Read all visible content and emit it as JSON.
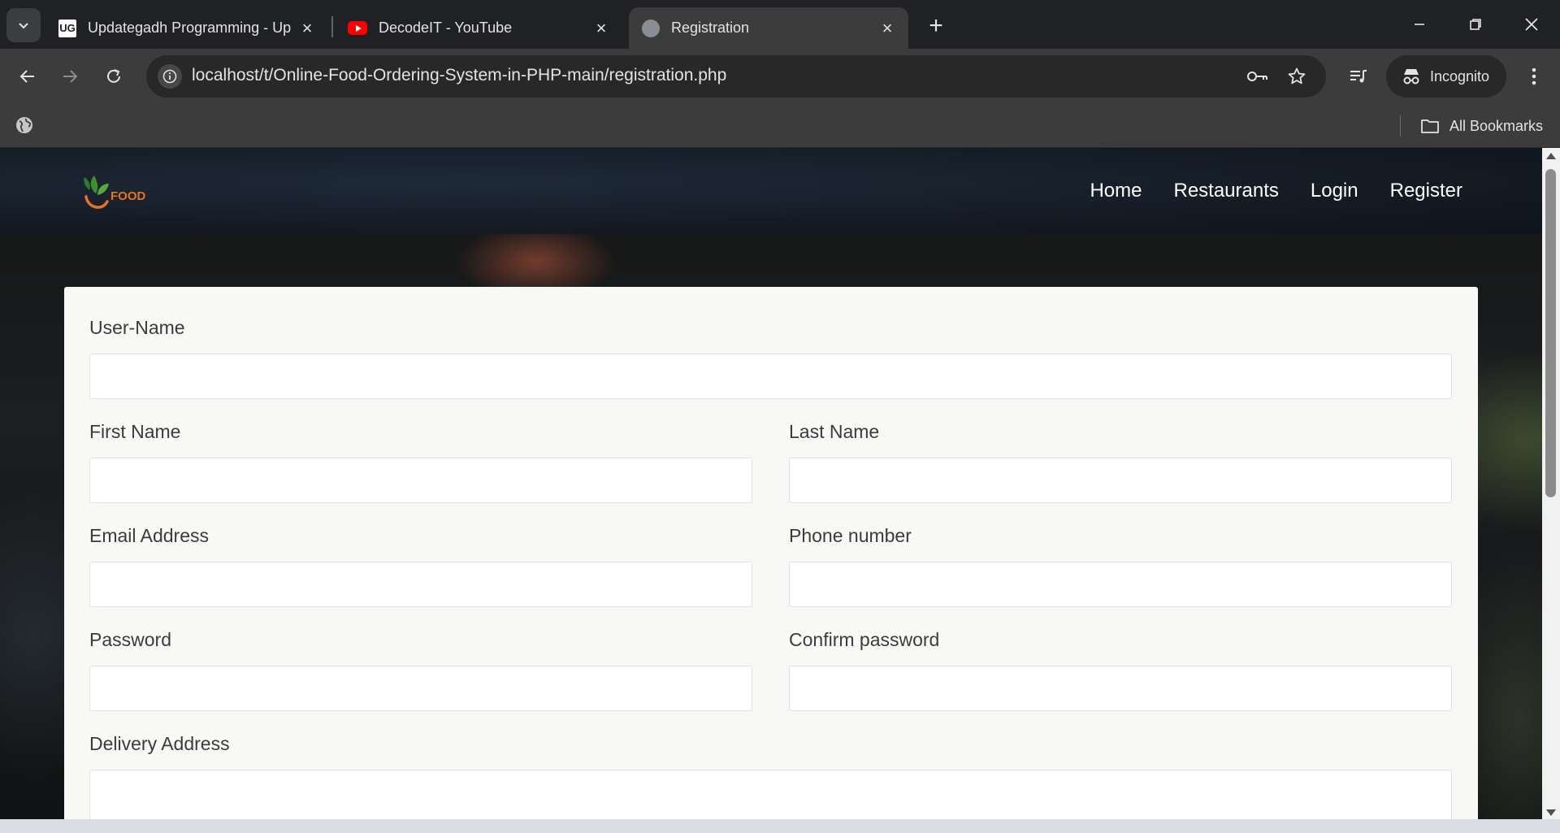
{
  "browser": {
    "tabs": [
      {
        "title": "Updategadh Programming - Up",
        "favicon": "ug-logo-icon",
        "active": false
      },
      {
        "title": "DecodeIT - YouTube",
        "favicon": "youtube-icon",
        "active": false
      },
      {
        "title": "Registration",
        "favicon": "globe-icon",
        "active": true
      }
    ],
    "url": "localhost/t/Online-Food-Ordering-System-in-PHP-main/registration.php",
    "incognito_label": "Incognito",
    "all_bookmarks_label": "All Bookmarks"
  },
  "site": {
    "logo_text": "FOOD",
    "nav": [
      "Home",
      "Restaurants",
      "Login",
      "Register"
    ]
  },
  "form": {
    "username_label": "User-Name",
    "first_name_label": "First Name",
    "last_name_label": "Last Name",
    "email_label": "Email Address",
    "phone_label": "Phone number",
    "password_label": "Password",
    "confirm_password_label": "Confirm password",
    "address_label": "Delivery Address"
  },
  "colors": {
    "logo_green": "#3f8f2f",
    "logo_orange": "#e8731c",
    "card_background": "#f8f8f6"
  }
}
